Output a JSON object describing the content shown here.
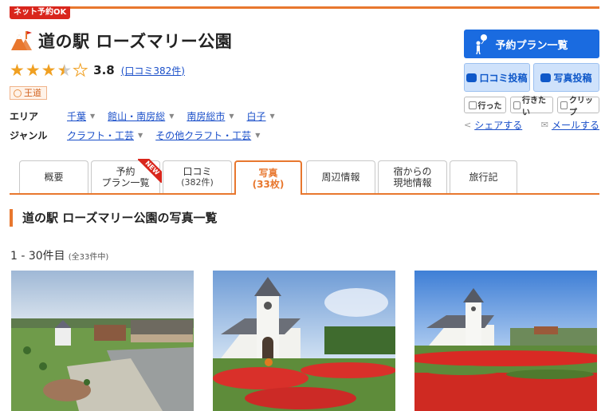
{
  "badge": "ネット予約OK",
  "title": "道の駅 ローズマリー公園",
  "rating": {
    "score": "3.8",
    "value": 3.8,
    "reviews_link": "(口コミ382件)"
  },
  "odo_label": "王道",
  "meta": {
    "area_label": "エリア",
    "area_items": [
      "千葉",
      "館山・南房総",
      "南房総市",
      "白子"
    ],
    "genre_label": "ジャンル",
    "genre_items": [
      "クラフト・工芸",
      "その他クラフト・工芸"
    ]
  },
  "side": {
    "plan_button": "予約プラン一覧",
    "review_button": "口コミ投稿",
    "photo_button": "写真投稿",
    "went_button": "行った",
    "want_button": "行きたい",
    "clip_button": "クリップ",
    "share_link": "シェアする",
    "mail_link": "メールする"
  },
  "tabs": [
    {
      "label": "概要",
      "sub": ""
    },
    {
      "label": "予約",
      "sub": "プラン一覧",
      "ribbon": "NEW"
    },
    {
      "label": "口コミ",
      "sub": "(382件)"
    },
    {
      "label": "写真",
      "sub": "(33枚)",
      "active": true
    },
    {
      "label": "周辺情報",
      "sub": ""
    },
    {
      "label": "宿からの",
      "sub": "現地情報"
    },
    {
      "label": "旅行記",
      "sub": ""
    }
  ],
  "section_title": "道の駅 ローズマリー公園の写真一覧",
  "count": {
    "range": "1 - 30件目",
    "total": "(全33件中)"
  },
  "colors": {
    "accent": "#e8772e",
    "brand_blue": "#1a6be0",
    "badge_red": "#d9261c"
  },
  "photo_icons": [
    "aerial-photo",
    "church-flowers-photo",
    "church-red-flowers-photo"
  ]
}
